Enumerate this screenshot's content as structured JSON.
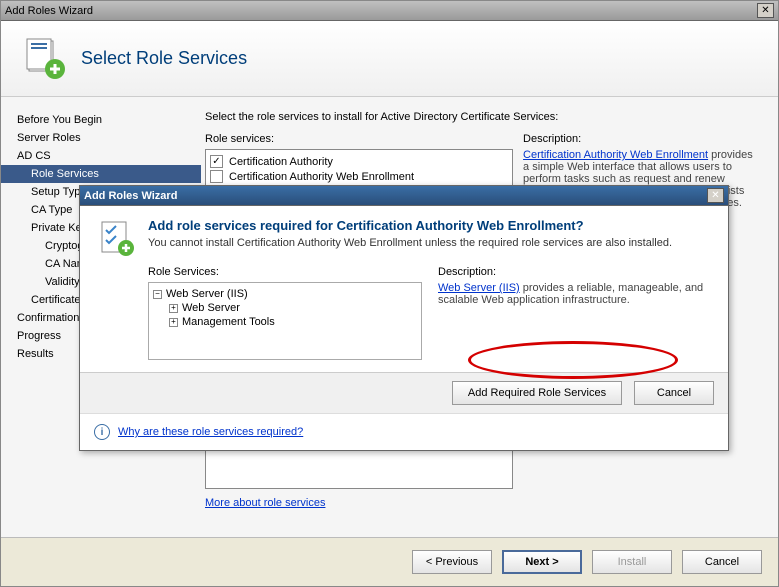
{
  "main": {
    "title": "Add Roles Wizard",
    "header_title": "Select Role Services",
    "nav": [
      {
        "label": "Before You Begin",
        "indent": 0
      },
      {
        "label": "Server Roles",
        "indent": 0
      },
      {
        "label": "AD CS",
        "indent": 0
      },
      {
        "label": "Role Services",
        "indent": 1,
        "selected": true
      },
      {
        "label": "Setup Type",
        "indent": 1
      },
      {
        "label": "CA Type",
        "indent": 1
      },
      {
        "label": "Private Key",
        "indent": 1
      },
      {
        "label": "Cryptography",
        "indent": 2
      },
      {
        "label": "CA Name",
        "indent": 2
      },
      {
        "label": "Validity Period",
        "indent": 2
      },
      {
        "label": "Certificate Database",
        "indent": 1
      },
      {
        "label": "Confirmation",
        "indent": 0
      },
      {
        "label": "Progress",
        "indent": 0
      },
      {
        "label": "Results",
        "indent": 0
      }
    ],
    "instruction": "Select the role services to install for Active Directory Certificate Services:",
    "role_label": "Role services:",
    "desc_label": "Description:",
    "services": [
      {
        "label": "Certification Authority",
        "checked": true
      },
      {
        "label": "Certification Authority Web Enrollment",
        "checked": false
      }
    ],
    "desc_link": "Certification Authority Web Enrollment",
    "desc_text": " provides a simple Web interface that allows users to perform tasks such as request and renew certificates, retrieve certificate revocation lists (CRLs), and enroll for smart card certificates.",
    "more_link": "More about role services",
    "buttons": {
      "prev": "< Previous",
      "next": "Next >",
      "install": "Install",
      "cancel": "Cancel"
    }
  },
  "dialog": {
    "title": "Add Roles Wizard",
    "heading": "Add role services required for Certification Authority Web Enrollment?",
    "message": "You cannot install Certification Authority Web Enrollment unless the required role services are also installed.",
    "role_label": "Role Services:",
    "desc_label": "Description:",
    "tree": {
      "root": "Web Server (IIS)",
      "children": [
        "Web Server",
        "Management Tools"
      ]
    },
    "desc_link": "Web Server (IIS)",
    "desc_text": " provides a reliable, manageable, and scalable Web application infrastructure.",
    "help_link": "Why are these role services required?",
    "buttons": {
      "add": "Add Required Role Services",
      "cancel": "Cancel"
    }
  }
}
